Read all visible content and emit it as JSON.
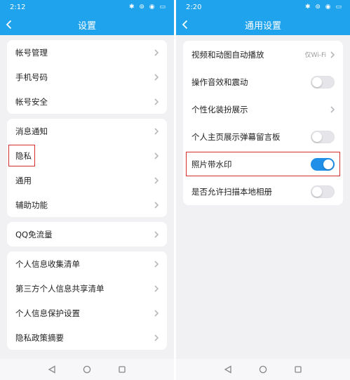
{
  "left_screen": {
    "status_bar": {
      "time": "2:12",
      "icons": "✱ ⊚ ◉ ▭"
    },
    "header": {
      "title": "设置"
    },
    "groups": [
      [
        {
          "label": "帐号管理"
        },
        {
          "label": "手机号码"
        },
        {
          "label": "帐号安全"
        }
      ],
      [
        {
          "label": "消息通知"
        },
        {
          "label": "隐私"
        },
        {
          "label": "通用"
        },
        {
          "label": "辅助功能"
        }
      ],
      [
        {
          "label": "QQ免流量"
        }
      ],
      [
        {
          "label": "个人信息收集清单"
        },
        {
          "label": "第三方个人信息共享清单"
        },
        {
          "label": "个人信息保护设置"
        },
        {
          "label": "隐私政策摘要"
        }
      ]
    ],
    "highlighted_item": "隐私"
  },
  "right_screen": {
    "status_bar": {
      "time": "2:20",
      "icons": "✱ ⊚ ◉ ▭"
    },
    "header": {
      "title": "通用设置"
    },
    "rows": [
      {
        "label": "视频和动图自动播放",
        "control": "chevron",
        "value": "仅Wi-Fi"
      },
      {
        "label": "操作音效和震动",
        "control": "toggle",
        "on": false
      },
      {
        "label": "个性化装扮展示",
        "control": "chevron"
      },
      {
        "label": "个人主页展示弹幕留言板",
        "control": "toggle",
        "on": false
      },
      {
        "label": "照片带水印",
        "control": "toggle",
        "on": true
      },
      {
        "label": "是否允许扫描本地相册",
        "control": "toggle",
        "on": false
      }
    ],
    "highlighted_item": "照片带水印"
  },
  "colors": {
    "header": "#1fa3ec",
    "toggle_on": "#1f8fe8",
    "highlight_box": "#d42d2d",
    "background": "#f1f1f3"
  },
  "icons": {
    "back": "chevron-left-icon",
    "row_arrow": "chevron-right-icon",
    "nav_back": "triangle-back-icon",
    "nav_home": "circle-home-icon",
    "nav_recent": "square-recents-icon"
  }
}
